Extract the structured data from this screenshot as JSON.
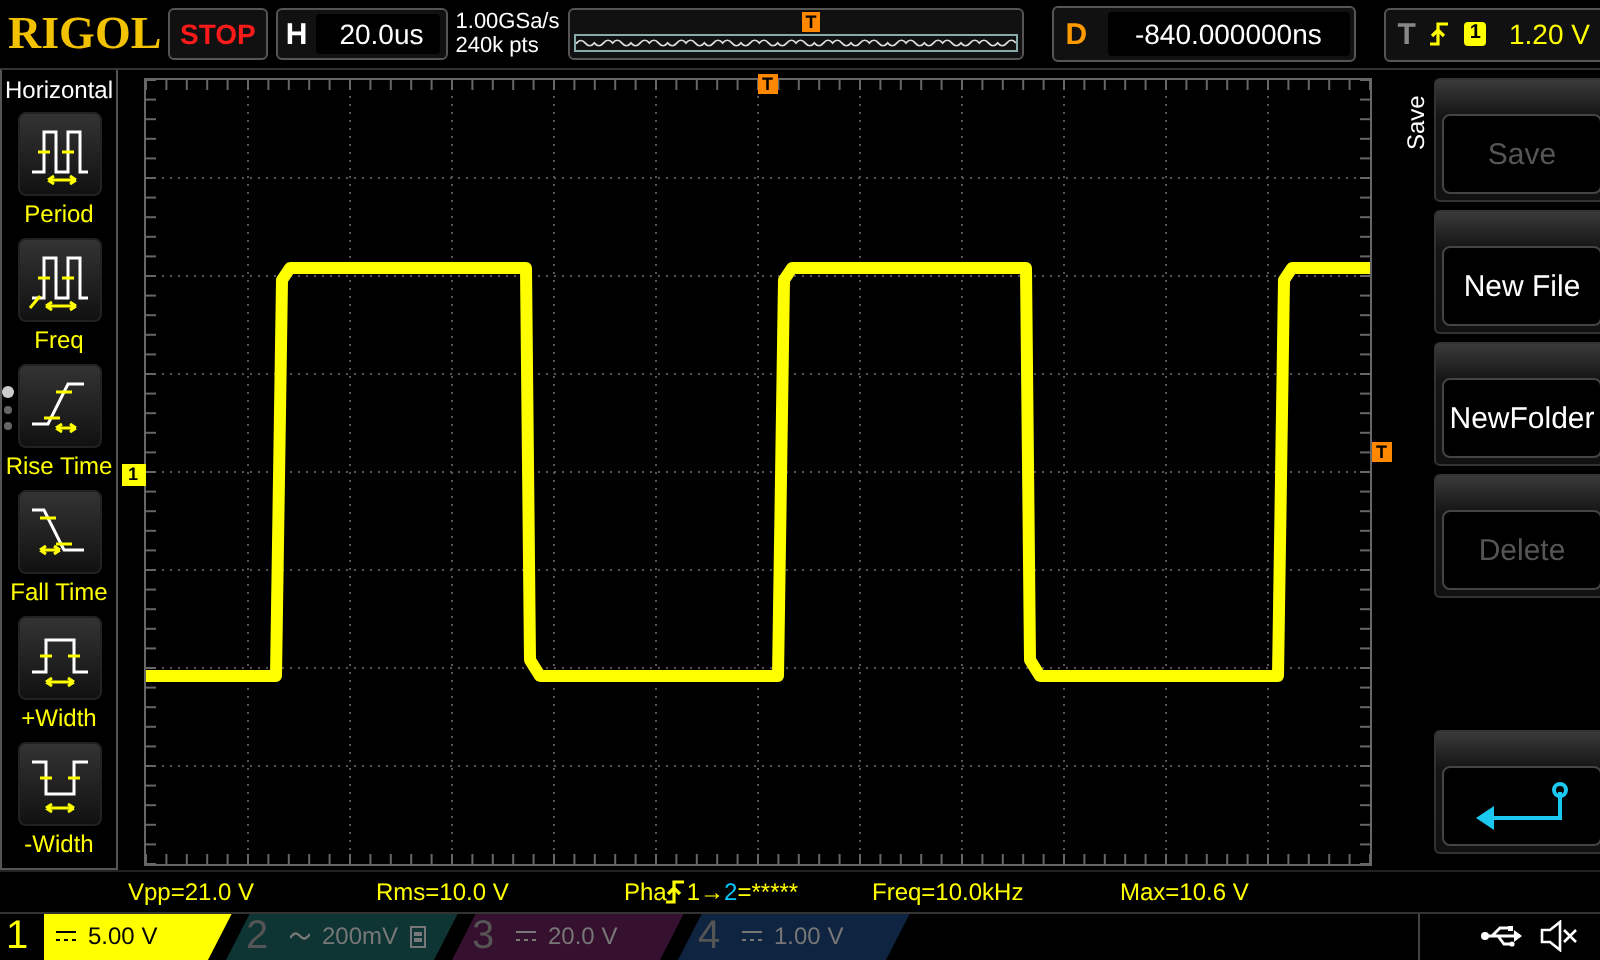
{
  "brand": "RIGOL",
  "run_state": "STOP",
  "horizontal": {
    "label": "H",
    "timebase": "20.0us"
  },
  "acquisition": {
    "sample_rate": "1.00GSa/s",
    "memory_depth": "240k pts"
  },
  "overview": {
    "trigger_marker": "T"
  },
  "delay": {
    "label": "D",
    "value": "-840.000000ns"
  },
  "trigger": {
    "label": "T",
    "slope": {
      "kind": "rising"
    },
    "source": "1",
    "level": "1.20 V"
  },
  "left_menu": {
    "title": "Horizontal",
    "page_dots": [
      {
        "selected": true
      },
      {
        "selected": false
      },
      {
        "selected": false
      }
    ],
    "items": [
      {
        "kind": "period",
        "label": "Period"
      },
      {
        "kind": "freq",
        "label": "Freq"
      },
      {
        "kind": "rise",
        "label": "Rise Time"
      },
      {
        "kind": "fall",
        "label": "Fall Time"
      },
      {
        "kind": "pwidth",
        "label": "+Width"
      },
      {
        "kind": "nwidth",
        "label": "-Width"
      }
    ]
  },
  "graticule": {
    "trigger_position_marker": "T",
    "trigger_level_marker": "T",
    "channel_marker": "1"
  },
  "right_menu": {
    "title": "Save",
    "items": [
      {
        "kind": "text",
        "label": "Save",
        "disabled": true
      },
      {
        "kind": "text",
        "label": "New File",
        "disabled": false
      },
      {
        "kind": "text",
        "label": "NewFolder",
        "disabled": false
      },
      {
        "kind": "text",
        "label": "Delete",
        "disabled": true
      },
      {
        "kind": "back"
      }
    ]
  },
  "measurements": [
    {
      "kind": "plain",
      "text": "Vpp=21.0 V"
    },
    {
      "kind": "plain",
      "text": "Rms=10.0 V"
    },
    {
      "kind": "phase",
      "prefix": "Pha",
      "from": "1→",
      "to": "2",
      "suffix": "=*****"
    },
    {
      "kind": "plain",
      "text": "Freq=10.0kHz"
    },
    {
      "kind": "plain",
      "text": "Max=10.6 V"
    }
  ],
  "channels": [
    {
      "number": "1",
      "coupling": {
        "kind": "dc"
      },
      "scale": "5.00 V",
      "on": true,
      "bw_limit": false,
      "color": "#ffff00"
    },
    {
      "number": "2",
      "coupling": {
        "kind": "ac"
      },
      "scale": "200mV",
      "on": false,
      "bw_limit": true,
      "color": "#0e3434"
    },
    {
      "number": "3",
      "coupling": {
        "kind": "dc"
      },
      "scale": "20.0 V",
      "on": false,
      "bw_limit": false,
      "color": "#36102f"
    },
    {
      "number": "4",
      "coupling": {
        "kind": "dc"
      },
      "scale": "1.00 V",
      "on": false,
      "bw_limit": false,
      "color": "#0f2440"
    }
  ]
}
